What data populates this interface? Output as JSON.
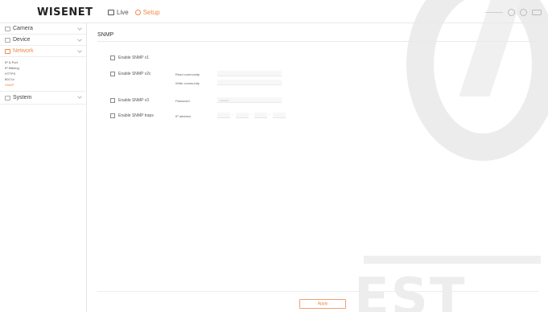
{
  "header": {
    "logo": "WISENET",
    "nav": {
      "live_label": "Live",
      "setup_label": "Setup"
    }
  },
  "sidebar": {
    "menus": [
      {
        "label": "Camera"
      },
      {
        "label": "Device"
      },
      {
        "label": "Network"
      },
      {
        "label": "System"
      }
    ],
    "network_items": [
      "IP & Port",
      "IP filtering",
      "HTTPS",
      "802.1x",
      "SNMP"
    ]
  },
  "main": {
    "title": "SNMP",
    "snmp_v1_label": "Enable SNMP v1",
    "snmp_v2c_label": "Enable SNMP v2c",
    "read_community_label": "Read community",
    "write_community_label": "Write community",
    "snmp_v3_label": "Enable SNMP v3",
    "password_label": "Password",
    "password_value": "••••••••",
    "traps_label": "Enable SNMP traps",
    "ip_address_label": "IP address",
    "ip_dots": [
      "·",
      "·",
      "·"
    ],
    "apply_label": "Apply"
  },
  "watermark": {
    "text": "EST"
  },
  "colors": {
    "accent": "#f08a4b"
  }
}
